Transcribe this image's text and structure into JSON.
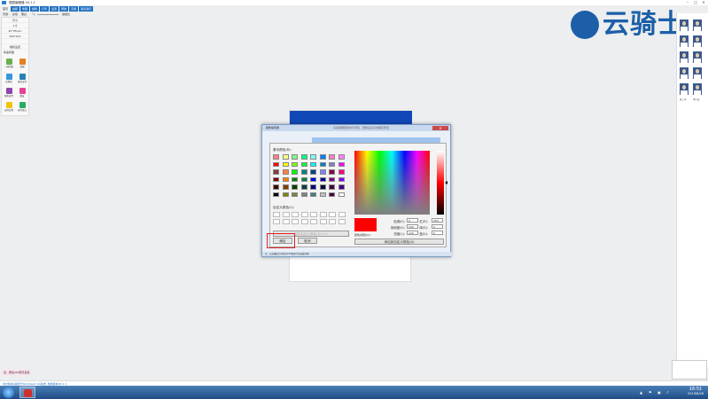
{
  "window": {
    "title": "图图编辑器 V4.1.1"
  },
  "menu": [
    "首页",
    "拍照",
    "修图",
    "编辑",
    "打印",
    "设置",
    "帮助",
    "高级",
    "联系我们"
  ],
  "toolbar": {
    "items": [
      "普通",
      "彩色",
      "黑白"
    ],
    "zoom_label": "缩放比"
  },
  "left_panel": {
    "rows": [
      "尺寸",
      "1寸",
      "25*35mm",
      "295*413",
      "",
      "相机设置"
    ],
    "section_label": "快速修图",
    "tools": [
      "一键美颜",
      "抠图",
      "背景色",
      "裁剪证件",
      "智能证件",
      "磨皮",
      "去除背景",
      "修复斑点",
      "制作排版",
      "批量处理"
    ]
  },
  "logo": {
    "text": "云骑士"
  },
  "right_panel": {
    "thumb_labels": [
      "张三丰",
      "李小龙"
    ]
  },
  "dialog": {
    "title": "图像编辑器",
    "title_info": "请选择要更换的背景色，更换后请点击确定按钮",
    "close_label": "✕",
    "status": "注：点击确定后可按住Ctrl键进行多选操作哦",
    "color_dialog": {
      "basic_colors_label": "基本颜色(B):",
      "custom_colors_label": "自定义颜色(C):",
      "define_custom_button": "规定自定义颜色(D) >>",
      "ok_button": "确定",
      "cancel_button": "取消",
      "color_solid_label": "颜色|纯色(O)",
      "add_custom_button": "添加到自定义颜色(A)",
      "fields": {
        "hue_label": "色调(E):",
        "hue": "0",
        "sat_label": "饱和度(S):",
        "sat": "240",
        "lum_label": "亮度(L):",
        "lum": "120",
        "red_label": "红(R):",
        "red": "255",
        "green_label": "绿(G):",
        "green": "0",
        "blue_label": "蓝(U):",
        "blue": "0"
      },
      "basic_colors": [
        "#ff8080",
        "#ffff80",
        "#80ff80",
        "#00ff80",
        "#80ffff",
        "#0080ff",
        "#ff80c0",
        "#ff80ff",
        "#ff0000",
        "#ffff00",
        "#80ff00",
        "#00ff40",
        "#00ffff",
        "#0080c0",
        "#8080c0",
        "#ff00ff",
        "#804040",
        "#ff8040",
        "#00ff00",
        "#008080",
        "#004080",
        "#8080ff",
        "#800040",
        "#ff0080",
        "#800000",
        "#ff8000",
        "#008000",
        "#008040",
        "#0000ff",
        "#0000a0",
        "#800080",
        "#8000ff",
        "#400000",
        "#804000",
        "#004000",
        "#004040",
        "#000080",
        "#000040",
        "#400040",
        "#400080",
        "#000000",
        "#808000",
        "#808040",
        "#808080",
        "#408080",
        "#c0c0c0",
        "#400040",
        "#ffffff"
      ],
      "preview_color": "#ff0000"
    }
  },
  "statusbar": {
    "left_text": "注：按住Ctrl键可多选",
    "bottom_text": "中文版本(适用于Windows7-10系统)  当前版本V4.1.1"
  },
  "taskbar": {
    "time": "16:51",
    "date": "2019/6/28"
  }
}
